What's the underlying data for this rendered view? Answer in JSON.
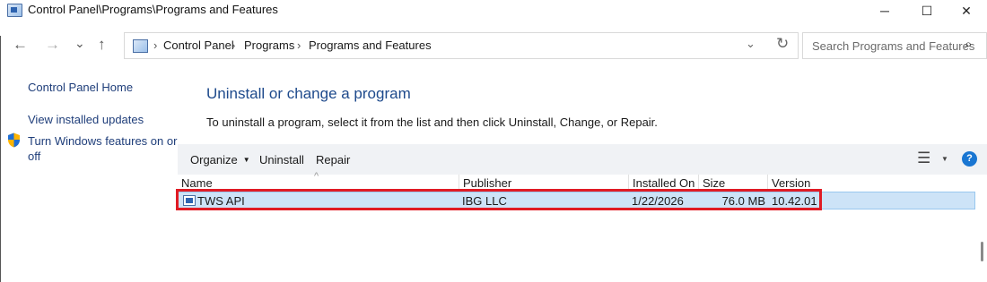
{
  "window": {
    "title": "Control Panel\\Programs\\Programs and Features",
    "icon": "control-panel-icon",
    "controls": {
      "minimize": "─",
      "maximize": "☐",
      "close": "✕"
    }
  },
  "nav": {
    "back": "←",
    "forward": "→",
    "recent": "⌄",
    "up": "↑",
    "breadcrumbs": [
      "Control Panel",
      "Programs",
      "Programs and Features"
    ],
    "separator": "›",
    "dropdown": "⌄",
    "refresh": "↻"
  },
  "search": {
    "placeholder": "Search Programs and Features",
    "icon": "⌕"
  },
  "left_pane": {
    "links": [
      "Control Panel Home",
      "View installed updates"
    ],
    "features_link": {
      "line1": "Turn Windows features on or",
      "line2": "off",
      "icon": "shield-icon"
    }
  },
  "main": {
    "heading": "Uninstall or change a program",
    "description": "To uninstall a program, select it from the list and then click Uninstall, Change, or Repair."
  },
  "toolbar": {
    "organize": "Organize",
    "caret": "▼",
    "uninstall": "Uninstall",
    "repair": "Repair",
    "view_icon": "☰",
    "help": "?"
  },
  "table": {
    "sort_indicator": "^",
    "columns": [
      "Name",
      "Publisher",
      "Installed On",
      "Size",
      "Version"
    ],
    "rows": [
      {
        "name": "TWS API",
        "publisher": "IBG LLC",
        "installed_on": "1/22/2026",
        "size": "76.0 MB",
        "version": "10.42.01"
      }
    ]
  },
  "colors": {
    "heading": "#1e4a8c",
    "link": "#1f3e7a",
    "selected_row": "#cde3f7",
    "highlight_box": "#e01b24",
    "help_blue": "#1976d2"
  }
}
